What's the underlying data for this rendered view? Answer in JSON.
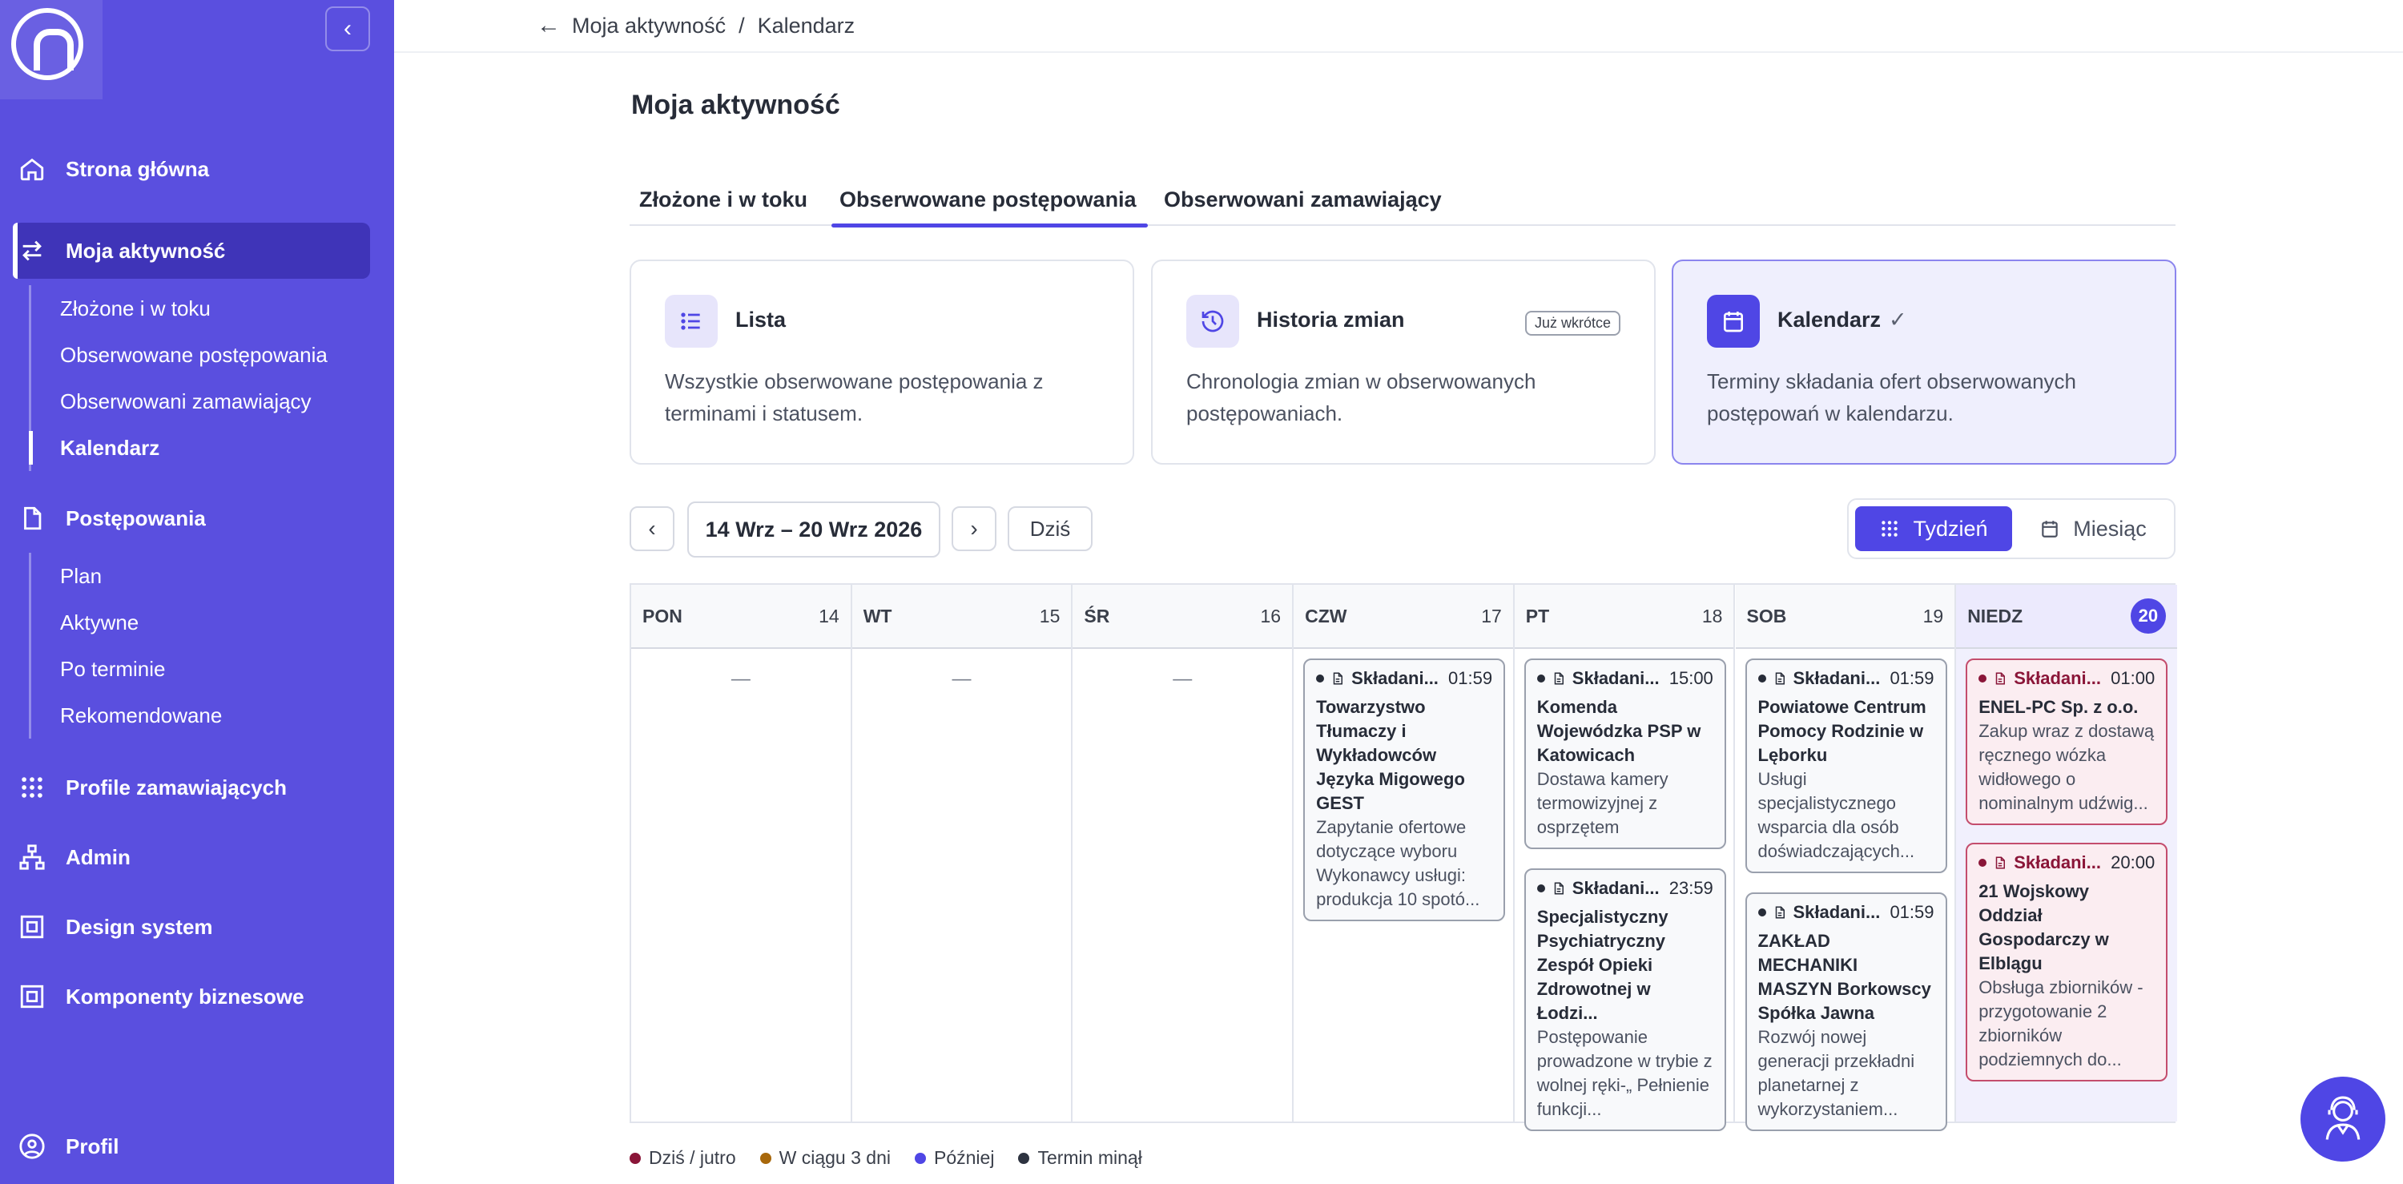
{
  "sidebar": {
    "main_items": [
      {
        "label": "Strona główna",
        "icon": "home-icon"
      },
      {
        "label": "Moja aktywność",
        "icon": "arrows-exchange-icon"
      },
      {
        "label": "Postępowania",
        "icon": "document-icon"
      },
      {
        "label": "Profile zamawiających",
        "icon": "grid-dots-icon"
      },
      {
        "label": "Admin",
        "icon": "hierarchy-icon"
      },
      {
        "label": "Design system",
        "icon": "frame-icon"
      },
      {
        "label": "Komponenty biznesowe",
        "icon": "frame-icon"
      },
      {
        "label": "Profil",
        "icon": "user-circle-icon"
      }
    ],
    "activity_sub": [
      "Złożone i w toku",
      "Obserwowane postępowania",
      "Obserwowani zamawiający",
      "Kalendarz"
    ],
    "proceedings_sub": [
      "Plan",
      "Aktywne",
      "Po terminie",
      "Rekomendowane"
    ]
  },
  "breadcrumb": {
    "parent": "Moja aktywność",
    "separator": "/",
    "current": "Kalendarz"
  },
  "page_title": "Moja aktywność",
  "tabs": [
    "Złożone i w toku",
    "Obserwowane postępowania",
    "Obserwowani zamawiający"
  ],
  "mode_cards": [
    {
      "title": "Lista",
      "desc": "Wszystkie obserwowane postępowania z terminami i statusem.",
      "icon": "list-icon"
    },
    {
      "title": "Historia zmian",
      "badge": "Już wkrótce",
      "desc": "Chronologia zmian w obserwowanych postępowaniach.",
      "icon": "history-icon"
    },
    {
      "title": "Kalendarz",
      "check": "✓",
      "desc": "Terminy składania ofert obserwowanych postępowań w kalendarzu.",
      "icon": "calendar-icon"
    }
  ],
  "date_range": "14 Wrz – 20 Wrz 2026",
  "today_label": "Dziś",
  "view_toggle": {
    "week": "Tydzień",
    "month": "Miesiąc"
  },
  "calendar": {
    "days": [
      {
        "name": "PON",
        "num": "14"
      },
      {
        "name": "WT",
        "num": "15"
      },
      {
        "name": "ŚR",
        "num": "16"
      },
      {
        "name": "CZW",
        "num": "17"
      },
      {
        "name": "PT",
        "num": "18"
      },
      {
        "name": "SOB",
        "num": "19"
      },
      {
        "name": "NIEDZ",
        "num": "20"
      }
    ],
    "empty_marker": "—",
    "events": {
      "thu": [
        {
          "type": "Składani...",
          "time": "01:59",
          "org": "Towarzystwo Tłumaczy i Wykładowców Języka Migowego GEST",
          "desc": "Zapytanie ofertowe dotyczące wyboru Wykonawcy usługi: produkcja 10 spotó..."
        }
      ],
      "fri": [
        {
          "type": "Składani...",
          "time": "15:00",
          "org": "Komenda Wojewódzka PSP w Katowicach",
          "desc": "Dostawa kamery termowizyjnej z osprzętem"
        },
        {
          "type": "Składani...",
          "time": "23:59",
          "org": "Specjalistyczny Psychiatryczny Zespół Opieki Zdrowotnej w Łodzi...",
          "desc": "Postępowanie prowadzone w trybie z wolnej ręki-„ Pełnienie funkcji..."
        }
      ],
      "sat": [
        {
          "type": "Składani...",
          "time": "01:59",
          "org": "Powiatowe Centrum Pomocy Rodzinie w Lęborku",
          "desc": "Usługi specjalistycznego wsparcia dla osób doświadczających..."
        },
        {
          "type": "Składani...",
          "time": "01:59",
          "org": "ZAKŁAD MECHANIKI MASZYN Borkowscy Spółka Jawna",
          "desc": "Rozwój nowej generacji przekładni planetarnej z wykorzystaniem..."
        }
      ],
      "sun": [
        {
          "type": "Składani...",
          "time": "01:00",
          "org": "ENEL-PC Sp. z o.o.",
          "desc": "Zakup wraz z dostawą ręcznego wózka widłowego o nominalnym udźwig..."
        },
        {
          "type": "Składani...",
          "time": "20:00",
          "org": "21 Wojskowy Oddział Gospodarczy w Elblągu",
          "desc": "Obsługa zbiorników - przygotowanie 2 zbiorników podziemnych do..."
        }
      ]
    }
  },
  "legend": [
    {
      "label": "Dziś / jutro",
      "color": "#8a1538"
    },
    {
      "label": "W ciągu 3 dni",
      "color": "#a8680c"
    },
    {
      "label": "Później",
      "color": "#4f46e5"
    },
    {
      "label": "Termin minął",
      "color": "#2d3340"
    }
  ],
  "colors": {
    "sidebar": "#5a4fdf",
    "accent": "#4f46e5",
    "urgent": "#8a1538"
  }
}
